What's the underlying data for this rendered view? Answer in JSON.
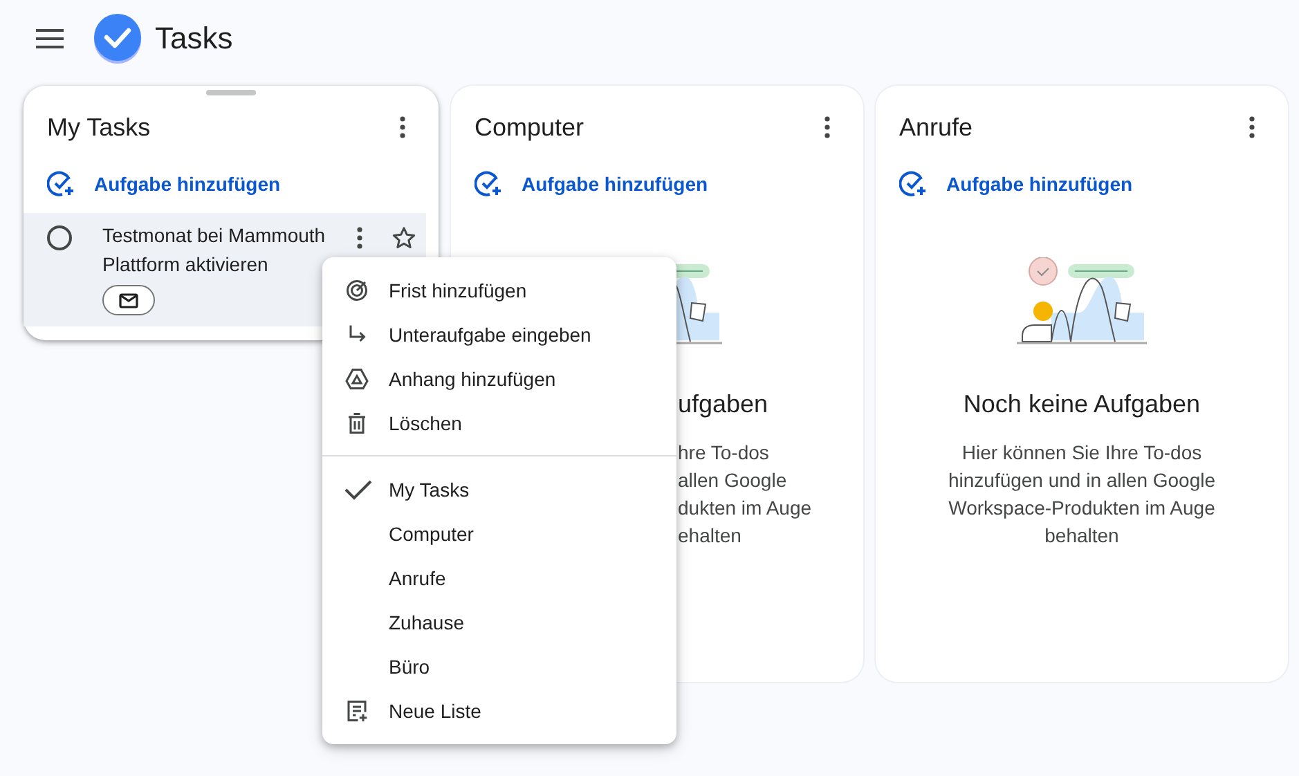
{
  "app": {
    "title": "Tasks"
  },
  "lists": [
    {
      "title": "My Tasks",
      "focused": true,
      "add_label": "Aufgabe hinzufügen",
      "tasks": [
        {
          "title_lines": [
            "Testmonat bei Mammouth",
            "Plattform aktivieren"
          ],
          "completed": false,
          "starred": false,
          "linked_email": true
        }
      ]
    },
    {
      "title": "Computer",
      "focused": false,
      "add_label": "Aufgabe hinzufügen",
      "empty": {
        "kind": "partial",
        "title": "ufgaben",
        "lines": [
          "hre To-dos",
          "allen Google",
          "dukten im Auge",
          "ehalten"
        ]
      }
    },
    {
      "title": "Anrufe",
      "focused": false,
      "add_label": "Aufgabe hinzufügen",
      "empty": {
        "kind": "full",
        "title": "Noch keine Aufgaben",
        "lines": [
          "Hier können Sie Ihre To-dos",
          "hinzufügen und in allen Google",
          "Workspace-Produkten im Auge",
          "behalten"
        ]
      }
    }
  ],
  "menu": {
    "actions": [
      {
        "label": "Frist hinzufügen",
        "kind": "deadline"
      },
      {
        "label": "Unteraufgabe eingeben",
        "kind": "subtask"
      },
      {
        "label": "Anhang hinzufügen",
        "kind": "attachment"
      },
      {
        "label": "Löschen",
        "kind": "delete"
      }
    ],
    "lists": [
      {
        "label": "My Tasks",
        "selected": true
      },
      {
        "label": "Computer",
        "selected": false
      },
      {
        "label": "Anrufe",
        "selected": false
      },
      {
        "label": "Zuhause",
        "selected": false
      },
      {
        "label": "Büro",
        "selected": false
      }
    ],
    "new_list": {
      "label": "Neue Liste"
    }
  }
}
